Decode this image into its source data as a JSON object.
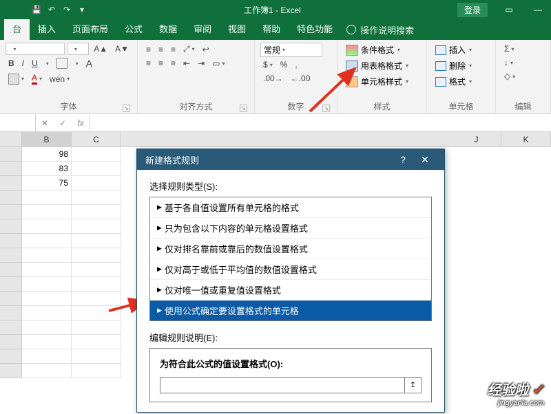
{
  "titlebar": {
    "title": "工作簿1 - Excel",
    "login": "登录"
  },
  "tabs": {
    "items": [
      "插入",
      "页面布局",
      "公式",
      "数据",
      "审阅",
      "视图",
      "帮助",
      "特色功能"
    ],
    "active_left": "台",
    "tell_me": "操作说明搜索"
  },
  "ribbon": {
    "font": {
      "label": "字体",
      "bold": "B",
      "italic": "I",
      "underline": "U",
      "pinyin": "wén"
    },
    "align": {
      "label": "对齐方式"
    },
    "number": {
      "label": "数字",
      "format": "常规"
    },
    "styles": {
      "label": "样式",
      "cond_format": "条件格式",
      "table_format": "用表格格式",
      "cell_styles": "单元格样式"
    },
    "cells": {
      "label": "单元格",
      "insert": "插入",
      "delete": "删除",
      "format": "格式"
    },
    "editing": {
      "label": "编辑"
    }
  },
  "formula_bar": {
    "name": "",
    "cancel": "✕",
    "confirm": "✓",
    "fx": "fx"
  },
  "columns": [
    "B",
    "C",
    "J",
    "K"
  ],
  "data_cells": [
    "98",
    "83",
    "75"
  ],
  "dialog": {
    "title": "新建格式规则",
    "help": "?",
    "close": "✕",
    "select_type_label": "选择规则类型(S):",
    "rules": [
      "基于各自值设置所有单元格的格式",
      "只为包含以下内容的单元格设置格式",
      "仅对排名靠前或靠后的数值设置格式",
      "仅对高于或低于平均值的数值设置格式",
      "仅对唯一值或重复值设置格式",
      "使用公式确定要设置格式的单元格"
    ],
    "edit_desc_label": "编辑规则说明(E):",
    "formula_label": "为符合此公式的值设置格式(O):",
    "ref_btn": "↥"
  },
  "watermark": {
    "main": "经验啦",
    "check": "✓",
    "sub": "jingyanla.com"
  }
}
